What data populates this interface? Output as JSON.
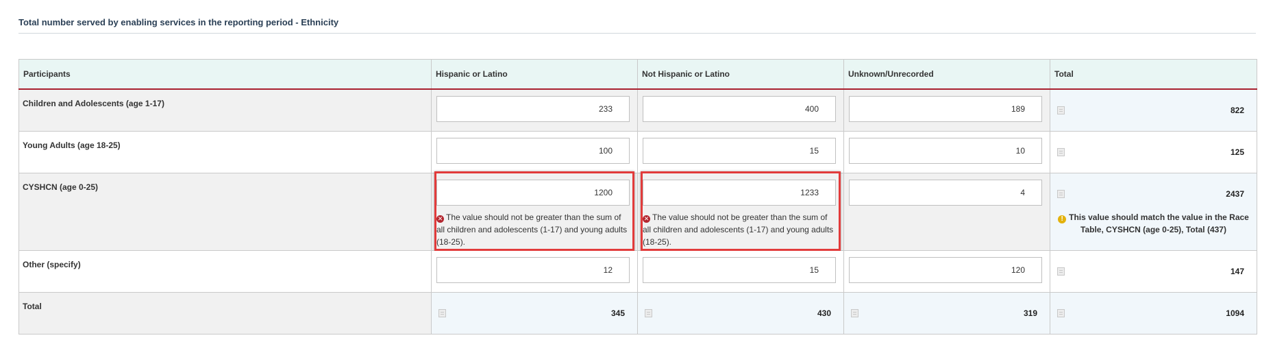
{
  "page_title": "Total number served by enabling services in the reporting period - Ethnicity",
  "columns": [
    "Participants",
    "Hispanic or Latino",
    "Not Hispanic or Latino",
    "Unknown/Unrecorded",
    "Total"
  ],
  "rows": [
    {
      "label": "Children and Adolescents (age 1-17)",
      "values": [
        "233",
        "400",
        "189"
      ],
      "total": "822"
    },
    {
      "label": "Young Adults (age 18-25)",
      "values": [
        "100",
        "15",
        "10"
      ],
      "total": "125"
    },
    {
      "label": "CYSHCN (age 0-25)",
      "values": [
        "1200",
        "1233",
        "4"
      ],
      "total": "2437"
    },
    {
      "label": "Other (specify)",
      "values": [
        "12",
        "15",
        "120"
      ],
      "total": "147"
    }
  ],
  "totals_row": {
    "label": "Total",
    "values": [
      "345",
      "430",
      "319"
    ],
    "total": "1094"
  },
  "errors": {
    "cyshcn_hispanic": "The value should not be greater than the sum of all children and adolescents (1-17) and young adults (18-25).",
    "cyshcn_not_hispanic": "The value should not be greater than the sum of all children and adolescents (1-17) and young adults (18-25)."
  },
  "warnings": {
    "cyshcn_total": "This value should match the value in the Race Table, CYSHCN (age 0-25), Total (437)"
  },
  "colors": {
    "header_bg": "#e9f6f4",
    "header_border": "#a8202e",
    "error": "#e23b3b",
    "warning": "#e3b20c"
  },
  "icons": {
    "error": "x-circle-icon",
    "warning": "exclamation-circle-icon",
    "calculated": "calculator-icon"
  }
}
